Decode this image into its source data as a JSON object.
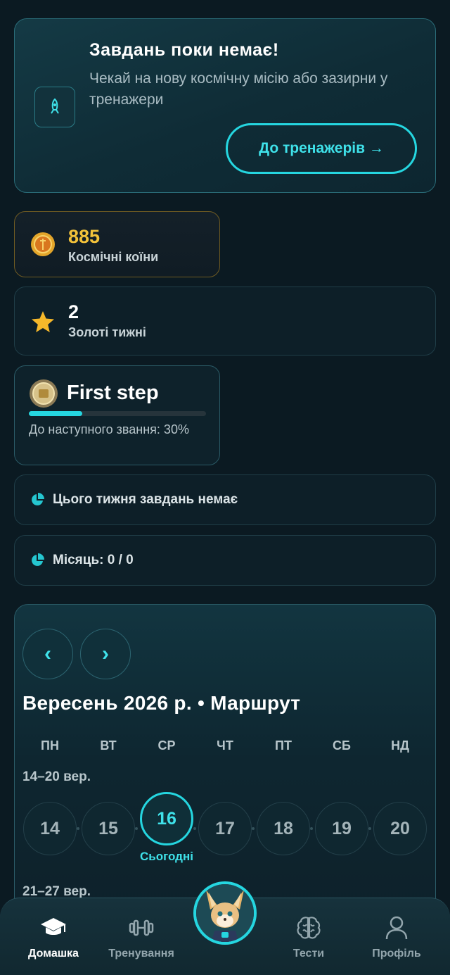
{
  "mission": {
    "title": "Завдань поки немає!",
    "description": "Чекай на нову космічну місію або зазирни у тренажери",
    "cta_label": "До тренажерів →"
  },
  "stats": {
    "coins": {
      "value": "885",
      "label": "Космічні коїни"
    },
    "gold_weeks": {
      "value": "2",
      "label": "Золоті тижні"
    }
  },
  "rank": {
    "name": "First step",
    "progress_fraction": 0.3,
    "next_label": "До наступного звання: 30%"
  },
  "tasks": {
    "week_text": "Цього тижня завдань немає",
    "month_text": "Місяць: 0 / 0"
  },
  "calendar": {
    "prev_label": "‹",
    "next_label": "›",
    "title": "Вересень 2026 р. • Маршрут",
    "weekdays": [
      "ПН",
      "ВТ",
      "СР",
      "ЧТ",
      "ПТ",
      "СБ",
      "НД"
    ],
    "weeks": [
      {
        "label": "14–20 вер.",
        "days": [
          "14",
          "15",
          "16",
          "17",
          "18",
          "19",
          "20"
        ],
        "today_index": 2
      },
      {
        "label": "21–27 вер."
      }
    ],
    "today_label": "Сьогодні"
  },
  "bottom_nav": {
    "items": [
      {
        "label": "Домашка",
        "icon": "graduation-cap-icon",
        "active": true
      },
      {
        "label": "Тренування",
        "icon": "dumbbell-icon",
        "active": false
      },
      {
        "label": "Тести",
        "icon": "brain-icon",
        "active": false
      },
      {
        "label": "Профіль",
        "icon": "user-icon",
        "active": false
      }
    ]
  },
  "colors": {
    "accent": "#25d6e0",
    "coin": "#f2c23a",
    "background": "#0b1a22"
  }
}
